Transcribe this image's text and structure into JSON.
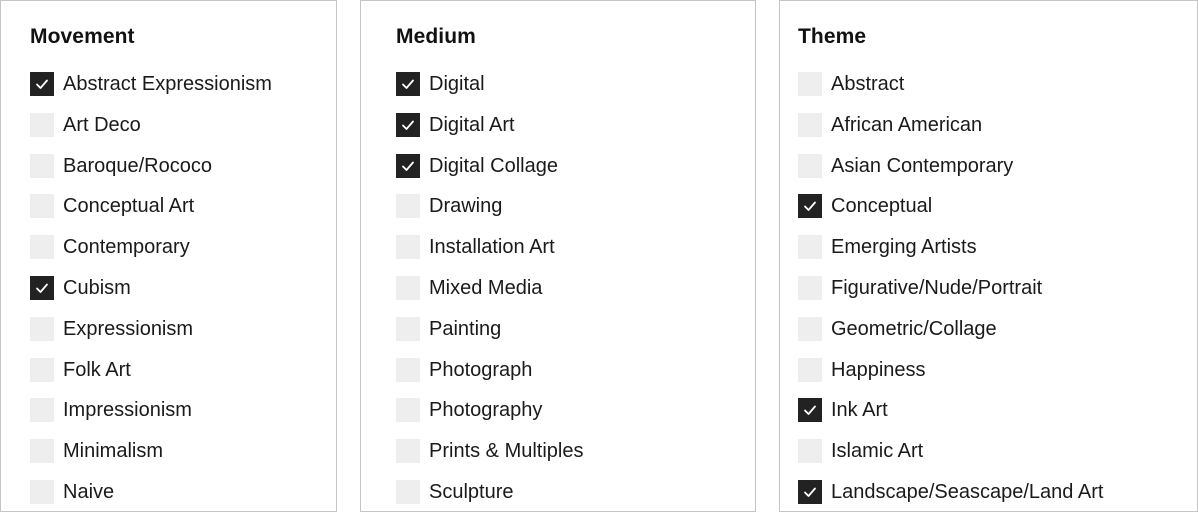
{
  "filters": [
    {
      "title": "Movement",
      "options": [
        {
          "label": "Abstract Expressionism",
          "checked": true
        },
        {
          "label": "Art Deco",
          "checked": false
        },
        {
          "label": "Baroque/Rococo",
          "checked": false
        },
        {
          "label": "Conceptual Art",
          "checked": false
        },
        {
          "label": "Contemporary",
          "checked": false
        },
        {
          "label": "Cubism",
          "checked": true
        },
        {
          "label": "Expressionism",
          "checked": false
        },
        {
          "label": "Folk Art",
          "checked": false
        },
        {
          "label": "Impressionism",
          "checked": false
        },
        {
          "label": "Minimalism",
          "checked": false
        },
        {
          "label": "Naive",
          "checked": false
        }
      ]
    },
    {
      "title": "Medium",
      "options": [
        {
          "label": "Digital",
          "checked": true
        },
        {
          "label": "Digital Art",
          "checked": true
        },
        {
          "label": "Digital Collage",
          "checked": true
        },
        {
          "label": "Drawing",
          "checked": false
        },
        {
          "label": "Installation Art",
          "checked": false
        },
        {
          "label": "Mixed Media",
          "checked": false
        },
        {
          "label": "Painting",
          "checked": false
        },
        {
          "label": "Photograph",
          "checked": false
        },
        {
          "label": "Photography",
          "checked": false
        },
        {
          "label": "Prints & Multiples",
          "checked": false
        },
        {
          "label": "Sculpture",
          "checked": false
        }
      ]
    },
    {
      "title": "Theme",
      "options": [
        {
          "label": "Abstract",
          "checked": false
        },
        {
          "label": "African American",
          "checked": false
        },
        {
          "label": "Asian Contemporary",
          "checked": false
        },
        {
          "label": "Conceptual",
          "checked": true
        },
        {
          "label": "Emerging Artists",
          "checked": false
        },
        {
          "label": "Figurative/Nude/Portrait",
          "checked": false
        },
        {
          "label": "Geometric/Collage",
          "checked": false
        },
        {
          "label": "Happiness",
          "checked": false
        },
        {
          "label": "Ink Art",
          "checked": true
        },
        {
          "label": "Islamic Art",
          "checked": false
        },
        {
          "label": "Landscape/Seascape/Land Art",
          "checked": true
        }
      ]
    }
  ],
  "colors": {
    "checkbox_checked": "#222222",
    "checkbox_unchecked": "#eeeeee",
    "checkmark": "#ffffff"
  }
}
